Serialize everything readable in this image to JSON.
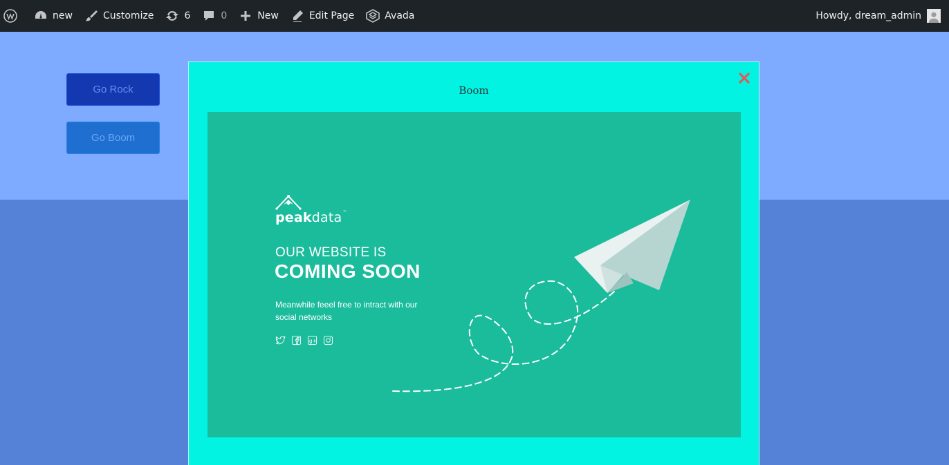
{
  "adminbar": {
    "site_name": "new",
    "customize": "Customize",
    "updates_count": "6",
    "comments_count": "0",
    "new_label": "New",
    "edit_page": "Edit Page",
    "theme": "Avada",
    "howdy": "Howdy, dream_admin",
    "icons": [
      "wordpress-icon",
      "dashboard-icon",
      "brush-icon",
      "updates-icon",
      "comment-icon",
      "plus-icon",
      "pencil-icon",
      "avada-icon",
      "avatar-icon"
    ]
  },
  "buttons": {
    "rock": "Go Rock",
    "boom": "Go Boom"
  },
  "popup": {
    "title": "Boom",
    "close_icon": "close-x-icon",
    "poster": {
      "logo_bold": "peak",
      "logo_light": "data",
      "logo_tm": "™",
      "heading_line1": "OUR WEBSITE IS",
      "heading_line2": "COMING SOON",
      "description": "Meanwhile feeel free to intract with our social networks",
      "social_icons": [
        "twitter-icon",
        "facebook-icon",
        "google-plus-icon",
        "instagram-icon"
      ]
    }
  },
  "colors": {
    "adminbar_bg": "#1d2327",
    "page_top_bg": "#7eabff",
    "page_bottom_bg": "#5581d7",
    "popup_bg": "#02f3e2",
    "poster_bg": "#1abc9c",
    "close_color": "#e05a5a",
    "go_rock_bg": "#1438b0",
    "go_boom_bg": "#1e6fd0"
  }
}
